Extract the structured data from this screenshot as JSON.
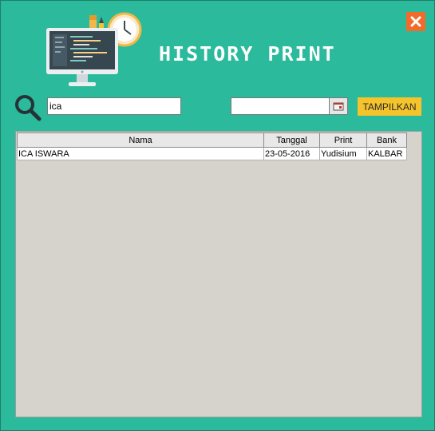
{
  "window": {
    "title": "HISTORY PRINT"
  },
  "toolbar": {
    "search_value": "ica",
    "date_value": "",
    "show_label": "TAMPILKAN"
  },
  "table": {
    "columns": [
      "Nama",
      "Tanggal",
      "Print",
      "Bank"
    ],
    "rows": [
      [
        "ICA ISWARA",
        "23-05-2016",
        "Yudisium",
        "KALBAR"
      ]
    ]
  },
  "icons": {
    "close": "close-icon",
    "search": "search-icon",
    "calendar": "calendar-icon",
    "logo": "computer-clock-logo"
  },
  "colors": {
    "background": "#2bba9b",
    "close_button": "#f26b2a",
    "show_button": "#f5c32c",
    "table_panel": "#d6d3cc"
  }
}
